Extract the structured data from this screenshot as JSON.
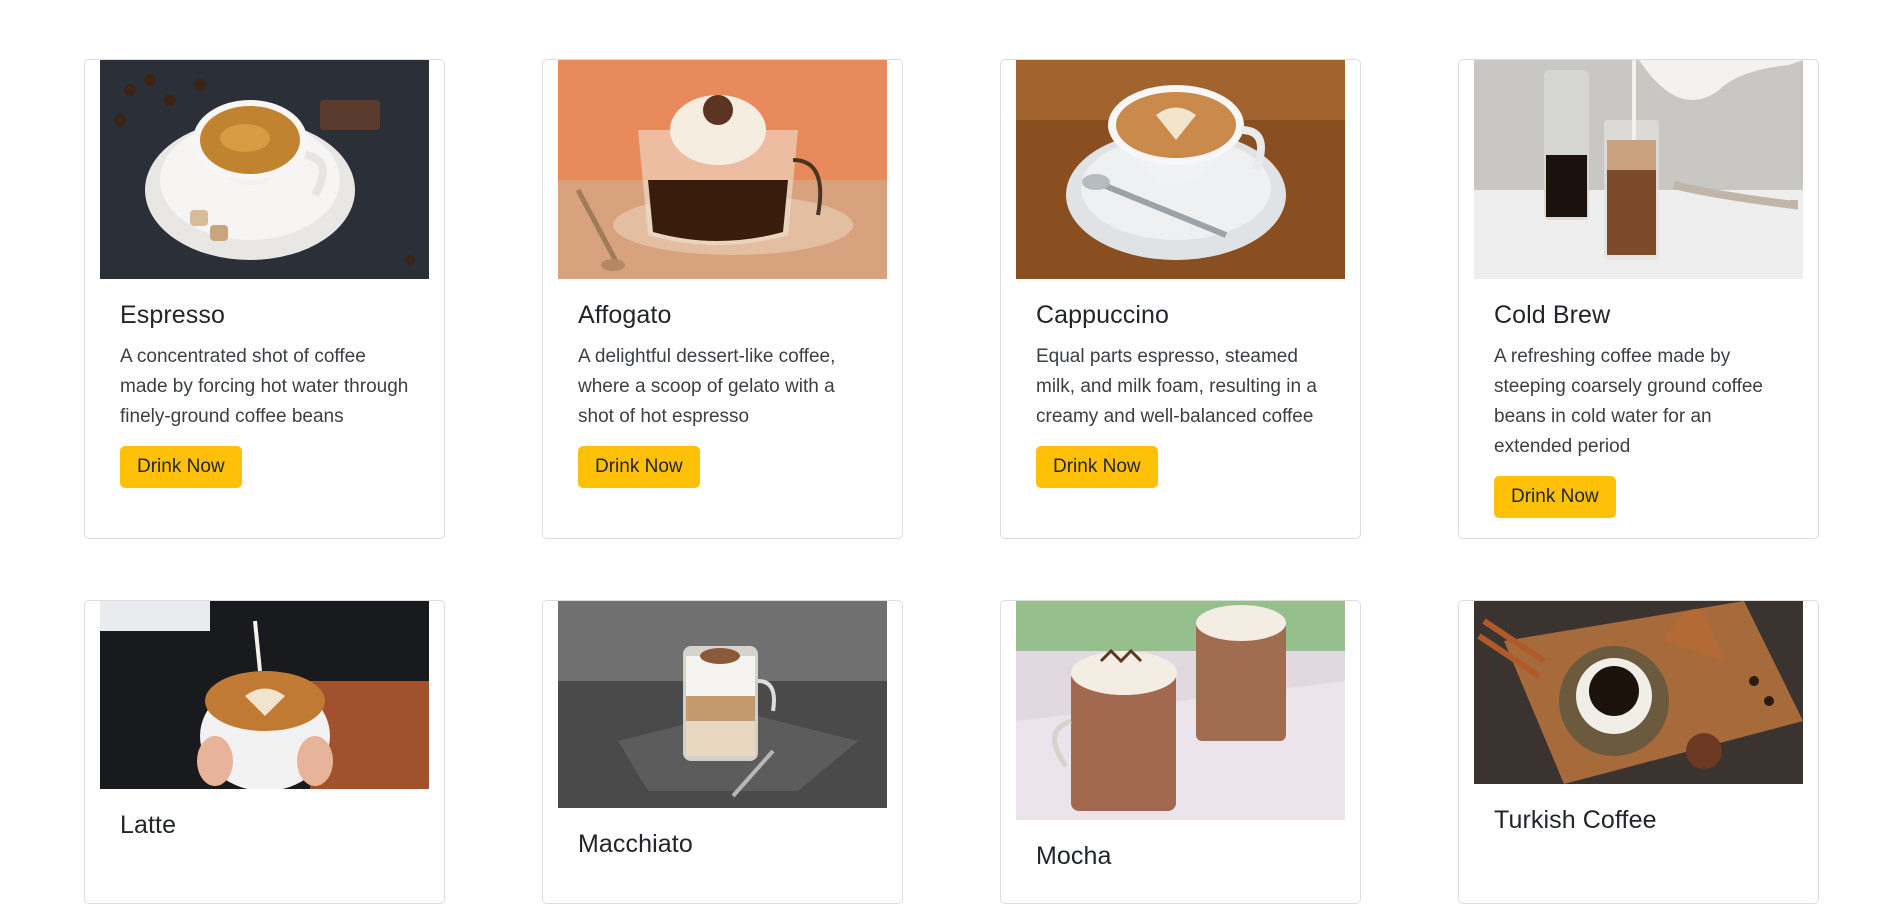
{
  "cards": [
    {
      "title": "Espresso",
      "text": "A concentrated shot of coffee made by forcing hot water through finely-ground coffee beans",
      "button": "Drink Now",
      "image": "espresso-image"
    },
    {
      "title": "Affogato",
      "text": "A delightful dessert-like coffee, where a scoop of gelato with a shot of hot espresso",
      "button": "Drink Now",
      "image": "affogato-image"
    },
    {
      "title": "Cappuccino",
      "text": "Equal parts espresso, steamed milk, and milk foam, resulting in a creamy and well-balanced coffee",
      "button": "Drink Now",
      "image": "cappuccino-image"
    },
    {
      "title": "Cold Brew",
      "text": "A refreshing coffee made by steeping coarsely ground coffee beans in cold water for an extended period",
      "button": "Drink Now",
      "image": "cold-brew-image"
    },
    {
      "title": "Latte",
      "image": "latte-image"
    },
    {
      "title": "Macchiato",
      "image": "macchiato-image"
    },
    {
      "title": "Mocha",
      "image": "mocha-image"
    },
    {
      "title": "Turkish Coffee",
      "image": "turkish-coffee-image"
    }
  ],
  "colors": {
    "button": "#ffc107",
    "border": "#dcdcdc"
  }
}
